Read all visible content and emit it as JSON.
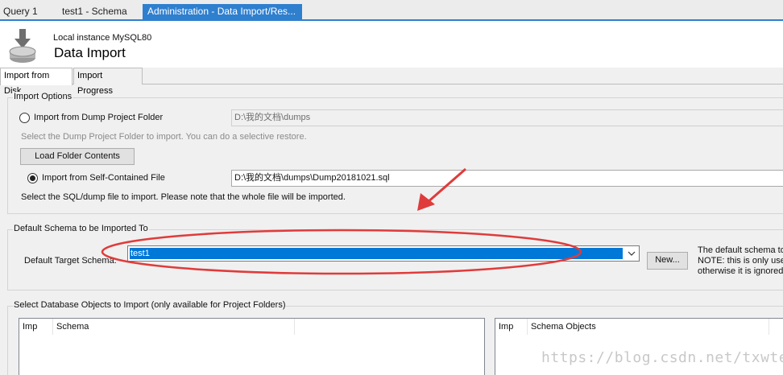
{
  "doc_tabs": [
    {
      "label": "Query 1"
    },
    {
      "label": "test1 - Schema"
    },
    {
      "label": "Administration - Data Import/Res..."
    }
  ],
  "header": {
    "subtitle": "Local instance MySQL80",
    "title": "Data Import"
  },
  "inner_tabs": [
    {
      "label": "Import from Disk"
    },
    {
      "label": "Import Progress"
    }
  ],
  "import_options": {
    "title": "Import Options",
    "dump_folder_option": "Import from Dump Project Folder",
    "dump_folder_path": "D:\\我的文档\\dumps",
    "dump_folder_hint": "Select the Dump Project Folder to import. You can do a selective restore.",
    "load_folder_button": "Load Folder Contents",
    "self_contained_option": "Import from Self-Contained File",
    "self_contained_path": "D:\\我的文档\\dumps\\Dump20181021.sql",
    "self_contained_hint": "Select the SQL/dump file to import. Please note that the whole file will be imported."
  },
  "default_schema": {
    "title": "Default Schema to be Imported To",
    "label": "Default Target Schema:",
    "selected": "test1",
    "new_button": "New...",
    "note_line1": "The default schema to",
    "note_line2": "NOTE: this is only used",
    "note_line3": "otherwise it is ignored."
  },
  "objects": {
    "title": "Select Database Objects to Import (only available for Project Folders)",
    "left_columns": [
      "Imp",
      "Schema"
    ],
    "right_columns": [
      "Imp",
      "Schema Objects"
    ]
  },
  "watermark": "https://blog.csdn.net/txwtech",
  "colors": {
    "accent": "#2f7fcf",
    "selection": "#0078d7",
    "annotation": "#e03b3b"
  }
}
